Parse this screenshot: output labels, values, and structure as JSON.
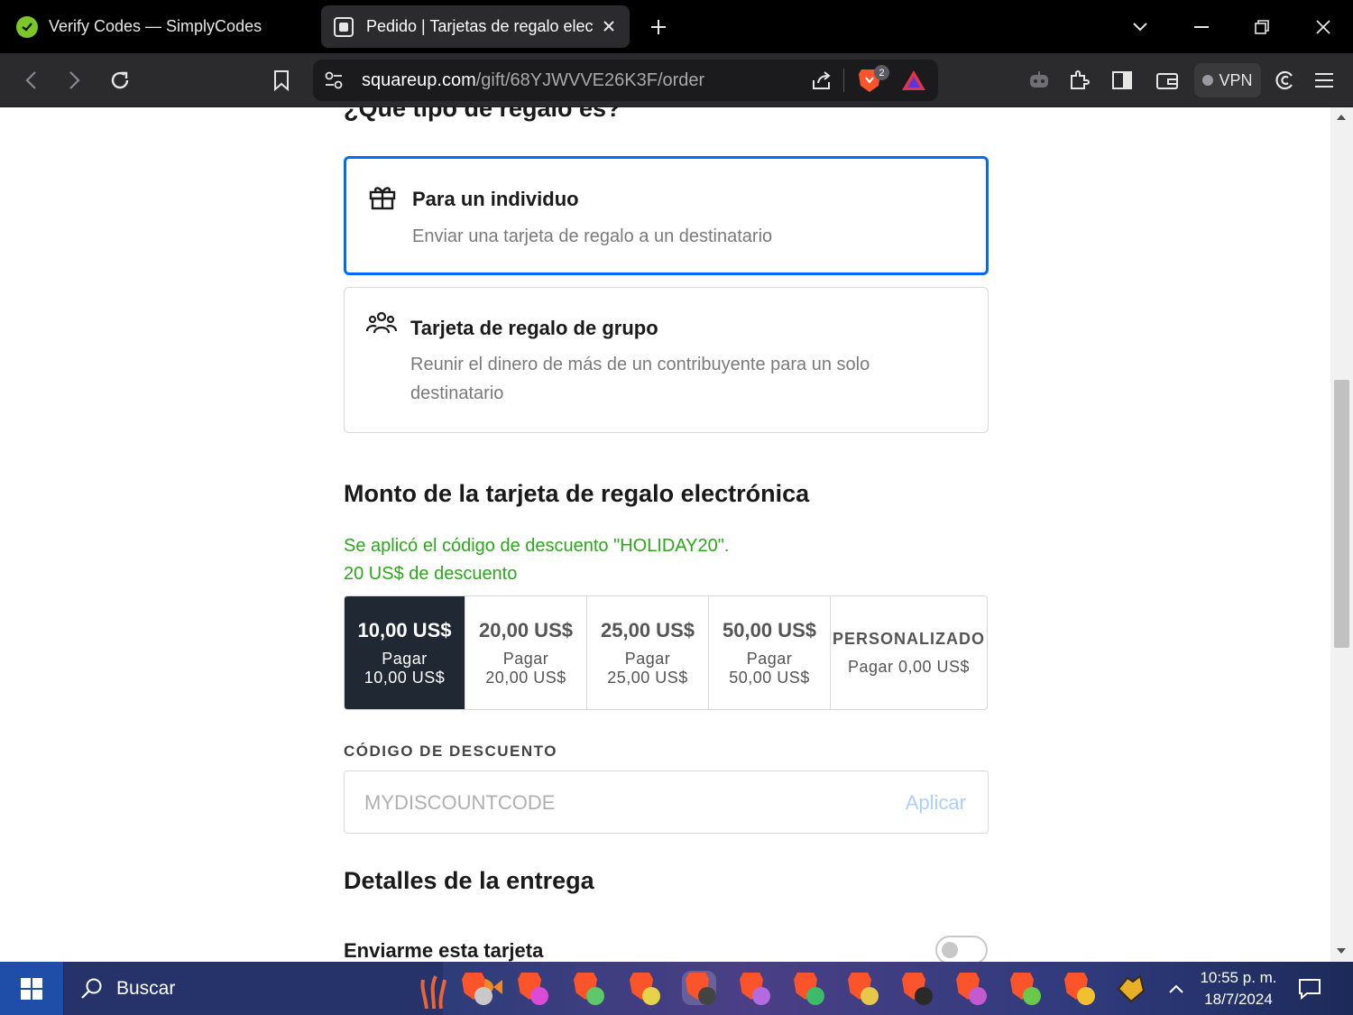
{
  "browser": {
    "tabs": [
      {
        "title": "Verify Codes — SimplyCodes",
        "active": false
      },
      {
        "title": "Pedido | Tarjetas de regalo electrónicas",
        "active": true
      }
    ],
    "url_host": "squareup.com",
    "url_path": "/gift/68YJWVVE26K3F/order",
    "shields_badge": "2",
    "vpn_label": "VPN"
  },
  "page": {
    "cut_heading": "¿Qué tipo de regalo es?",
    "gift_types": [
      {
        "title": "Para un individuo",
        "description": "Enviar una tarjeta de regalo a un destinatario",
        "selected": true,
        "icon": "gift-icon"
      },
      {
        "title": "Tarjeta de regalo de grupo",
        "description": "Reunir el dinero de más de un contribuyente para un solo destinatario",
        "selected": false,
        "icon": "group-icon"
      }
    ],
    "amount_section_title": "Monto de la tarjeta de regalo electrónica",
    "discount_applied_line1": "Se aplicó el código de descuento \"HOLIDAY20\".",
    "discount_applied_line2": "20 US$ de descuento",
    "amounts": [
      {
        "value": "10,00 US$",
        "pay_label": "Pagar",
        "pay_value": "10,00 US$",
        "selected": true
      },
      {
        "value": "20,00 US$",
        "pay_label": "Pagar",
        "pay_value": "20,00 US$",
        "selected": false
      },
      {
        "value": "25,00 US$",
        "pay_label": "Pagar",
        "pay_value": "25,00 US$",
        "selected": false
      },
      {
        "value": "50,00 US$",
        "pay_label": "Pagar",
        "pay_value": "50,00 US$",
        "selected": false
      }
    ],
    "custom_amount": {
      "label": "PERSONALIZADO",
      "pay_text": "Pagar 0,00 US$"
    },
    "discount_code_label": "CÓDIGO DE DESCUENTO",
    "discount_code_placeholder": "MYDISCOUNTCODE",
    "discount_code_value": "",
    "apply_label": "Aplicar",
    "delivery_title": "Detalles de la entrega",
    "send_to_me_label": "Enviarme esta tarjeta",
    "send_to_me_on": false
  },
  "taskbar": {
    "search_label": "Buscar",
    "time": "10:55 p. m.",
    "date": "18/7/2024"
  },
  "colors": {
    "selected_border": "#006aff",
    "selected_amount_bg": "#1f2833",
    "discount_green": "#2aa81a",
    "apply_link": "#a9d0ff"
  }
}
